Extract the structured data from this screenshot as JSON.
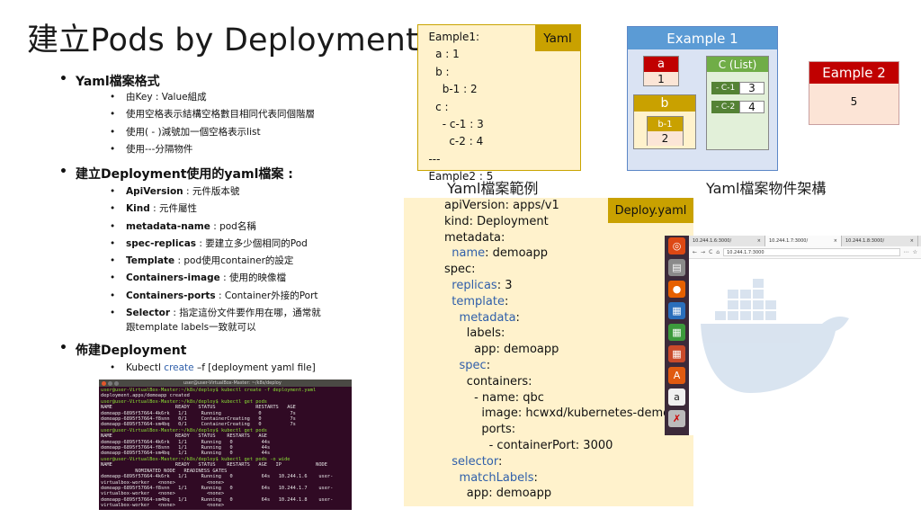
{
  "title": "建立Pods by Deployment",
  "left": {
    "sec1": {
      "heading": "Yaml檔案格式",
      "items": [
        "由Key : Value組成",
        "使用空格表示結構空格數目相同代表同個階層",
        "使用( - )減號加一個空格表示list",
        "使用---分隔物件"
      ]
    },
    "sec2": {
      "heading": "建立Deployment使用的yaml檔案 :",
      "items": [
        {
          "k": "ApiVersion",
          "v": " : 元件版本號"
        },
        {
          "k": "Kind",
          "v": " :  元件屬性"
        },
        {
          "k": "metadata-name",
          "v": " : pod名稱"
        },
        {
          "k": "spec-replicas",
          "v": " : 要建立多少個相同的Pod"
        },
        {
          "k": "Template",
          "v": " : pod使用container的設定"
        },
        {
          "k": "Containers-image",
          "v": " : 使用的映像檔"
        },
        {
          "k": "Containers-ports",
          "v": " : Container外接的Port"
        },
        {
          "k": "Selector",
          "v": " : 指定這份文件要作用在哪，通常就"
        }
      ],
      "selector_cont": "跟template labels一致就可以"
    },
    "sec3": {
      "heading": "佈建Deployment",
      "cmd_a": "Kubectl ",
      "cmd_b": "create",
      "cmd_c": " –f [deployment yaml file]"
    }
  },
  "terminal": {
    "title": "user@user-VirtualBox-Master: ~/k8s/deploy",
    "lines": [
      {
        "p": true,
        "t": "user@user-VirtualBox-Master:~/k8s/deploy$ kubectl create -f deployment.yaml"
      },
      {
        "p": false,
        "t": "deployment.apps/demoapp created"
      },
      {
        "p": true,
        "t": "user@user-VirtualBox-Master:~/k8s/deploy$ kubectl get pods"
      },
      {
        "p": false,
        "t": "NAME                      READY   STATUS              RESTARTS   AGE"
      },
      {
        "p": false,
        "t": "demoapp-6895f57664-4k6rk   1/1     Running             0          7s"
      },
      {
        "p": false,
        "t": "demoapp-6895f57664-f8snn   0/1     ContainerCreating   0          7s"
      },
      {
        "p": false,
        "t": "demoapp-6895f57664-sm4bq   0/1     ContainerCreating   0          7s"
      },
      {
        "p": true,
        "t": "user@user-VirtualBox-Master:~/k8s/deploy$ kubectl get pods"
      },
      {
        "p": false,
        "t": "NAME                      READY   STATUS    RESTARTS   AGE"
      },
      {
        "p": false,
        "t": "demoapp-6895f57664-4k6rk   1/1     Running   0          44s"
      },
      {
        "p": false,
        "t": "demoapp-6895f57664-f8snn   1/1     Running   0          44s"
      },
      {
        "p": false,
        "t": "demoapp-6895f57664-sm4bq   1/1     Running   0          44s"
      },
      {
        "p": true,
        "t": "user@user-VirtualBox-Master:~/k8s/deploy$ kubectl get pods -o wide"
      },
      {
        "p": false,
        "t": "NAME                      READY   STATUS    RESTARTS   AGE   IP            NODE"
      },
      {
        "p": false,
        "t": "            NOMINATED NODE   READINESS GATES"
      },
      {
        "p": false,
        "t": "demoapp-6895f57664-4k6rk   1/1     Running   0          64s   10.244.1.6    user-"
      },
      {
        "p": false,
        "t": "virtualbox-worker   <none>           <none>"
      },
      {
        "p": false,
        "t": "demoapp-6895f57664-f8snn   1/1     Running   0          64s   10.244.1.7    user-"
      },
      {
        "p": false,
        "t": "virtualbox-worker   <none>           <none>"
      },
      {
        "p": false,
        "t": "demoapp-6895f57664-sm4bq   1/1     Running   0          64s   10.244.1.8    user-"
      },
      {
        "p": false,
        "t": "virtualbox-worker   <none>           <none>"
      }
    ]
  },
  "yaml_example": {
    "tag": "Yaml",
    "lines": [
      "   Eample1:",
      "     a : 1",
      "     b :",
      "       b-1 : 2",
      "     c :",
      "       - c-1 : 3",
      "         c-2 : 4",
      "   ---",
      "   Eample2 : 5"
    ],
    "caption": "Yaml檔案範例"
  },
  "structure": {
    "ex1_title": "Example 1",
    "a_label": "a",
    "a_value": "1",
    "b_label": "b",
    "b1_label": "b-1",
    "b1_value": "2",
    "c_label": "C (List)",
    "c1_label": "- C-1",
    "c1_value": "3",
    "c2_label": "- C-2",
    "c2_value": "4",
    "ex2_title": "Eample 2",
    "ex2_value": "5",
    "caption": "Yaml檔案物件架構"
  },
  "deploy": {
    "tag": "Deploy.yaml",
    "lines": [
      {
        "i": "",
        "k": "apiVersion",
        "v": ": apps/v1",
        "c": false
      },
      {
        "i": "",
        "k": "kind",
        "v": ": Deployment",
        "c": false
      },
      {
        "i": "",
        "k": "metadata",
        "v": ":",
        "c": false
      },
      {
        "i": "  ",
        "k": "name",
        "v": ": demoapp",
        "c": true
      },
      {
        "i": "",
        "k": "spec",
        "v": ":",
        "c": false
      },
      {
        "i": "  ",
        "k": "replicas",
        "v": ": 3",
        "c": true
      },
      {
        "i": "  ",
        "k": "template",
        "v": ":",
        "c": true
      },
      {
        "i": "    ",
        "k": "metadata",
        "v": ":",
        "c": true
      },
      {
        "i": "      ",
        "k": "labels",
        "v": ":",
        "c": false
      },
      {
        "i": "        ",
        "k": "app",
        "v": ": demoapp",
        "c": false
      },
      {
        "i": "    ",
        "k": "spec",
        "v": ":",
        "c": true
      },
      {
        "i": "      ",
        "k": "containers",
        "v": ":",
        "c": false
      },
      {
        "i": "        ",
        "k": "- name",
        "v": ": qbc",
        "c": false
      },
      {
        "i": "          ",
        "k": "image",
        "v": ": hcwxd/kubernetes-demo",
        "c": false
      },
      {
        "i": "          ",
        "k": "ports",
        "v": ":",
        "c": false
      },
      {
        "i": "            ",
        "k": "- containerPort",
        "v": ": 3000",
        "c": false
      },
      {
        "i": "  ",
        "k": "selector",
        "v": ":",
        "c": true
      },
      {
        "i": "    ",
        "k": "matchLabels",
        "v": ":",
        "c": true
      },
      {
        "i": "      ",
        "k": "app",
        "v": ": demoapp",
        "c": false
      }
    ]
  },
  "browser": {
    "tabs": [
      "10.244.1.6:3000/",
      "10.244.1.7:3000/",
      "10.244.1.8:3000/"
    ],
    "url": "10.244.1.7:3000"
  },
  "colors": {
    "accent_blue": "#5b9bd5",
    "gold": "#c9a100",
    "red": "#c00000",
    "green": "#70ad47"
  }
}
